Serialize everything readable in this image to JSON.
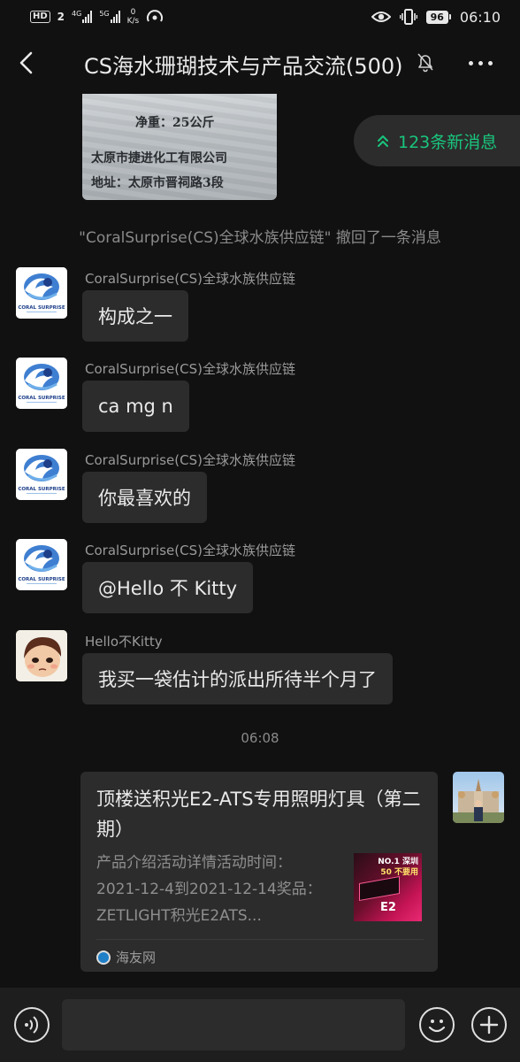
{
  "status_bar": {
    "hd_label": "HD",
    "sim1": "2",
    "net1": "4G",
    "net2": "5G",
    "speed_value": "0",
    "speed_unit": "K/s",
    "battery": "96",
    "time": "06:10"
  },
  "header": {
    "title": "CS海水珊瑚技术与产品交流(500)"
  },
  "photo_message": {
    "line1": "净重：25公斤",
    "line2": "太原市捷进化工有限公司",
    "line3": "地址：太原市晋祠路3段"
  },
  "new_messages_label": "123条新消息",
  "recall_notice": "\"CoralSurprise(CS)全球水族供应链\" 撤回了一条消息",
  "messages": [
    {
      "sender": "CoralSurprise(CS)全球水族供应链",
      "text": "构成之一"
    },
    {
      "sender": "CoralSurprise(CS)全球水族供应链",
      "text": "ca mg n"
    },
    {
      "sender": "CoralSurprise(CS)全球水族供应链",
      "text": "你最喜欢的"
    },
    {
      "sender": "CoralSurprise(CS)全球水族供应链",
      "text": "@Hello 不 Kitty"
    },
    {
      "sender": "Hello不Kitty",
      "text": "我买一袋估计的派出所待半个月了"
    }
  ],
  "avatar_caption": "CORAL SURPRISE",
  "timestamp": "06:08",
  "link_card": {
    "title": "顶楼送积光E2-ATS专用照明灯具（第二期）",
    "description": "产品介绍活动详情活动时间：2021-12-4到2021-12-14奖品：ZETLIGHT积光E2ATS...",
    "thumb_line1": "NO.1 深圳",
    "thumb_line2": "50 不要用",
    "thumb_line3": "E2",
    "source": "海友网"
  }
}
